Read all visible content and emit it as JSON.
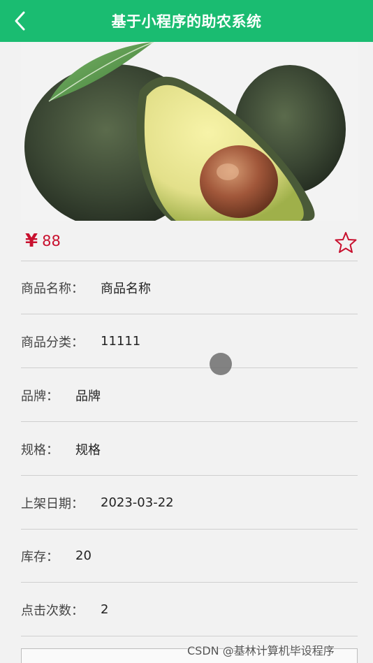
{
  "header": {
    "title": "基于小程序的助农系统",
    "back_icon": "chevron-left-icon",
    "bg_color": "#1abc71"
  },
  "hero": {
    "image_subject": "avocado"
  },
  "price": {
    "currency_symbol": "¥",
    "amount": "88",
    "color": "#c8102e",
    "favorite_icon": "star-outline-icon"
  },
  "details": [
    {
      "label": "商品名称：",
      "value": "商品名称"
    },
    {
      "label": "商品分类：",
      "value": "11111"
    },
    {
      "label": "品牌：",
      "value": "品牌"
    },
    {
      "label": "规格：",
      "value": "规格"
    },
    {
      "label": "上架日期：",
      "value": "2023-03-22"
    },
    {
      "label": "库存：",
      "value": "20"
    },
    {
      "label": "点击次数：",
      "value": "2"
    }
  ],
  "watermark": "CSDN @基林计算机毕设程序"
}
